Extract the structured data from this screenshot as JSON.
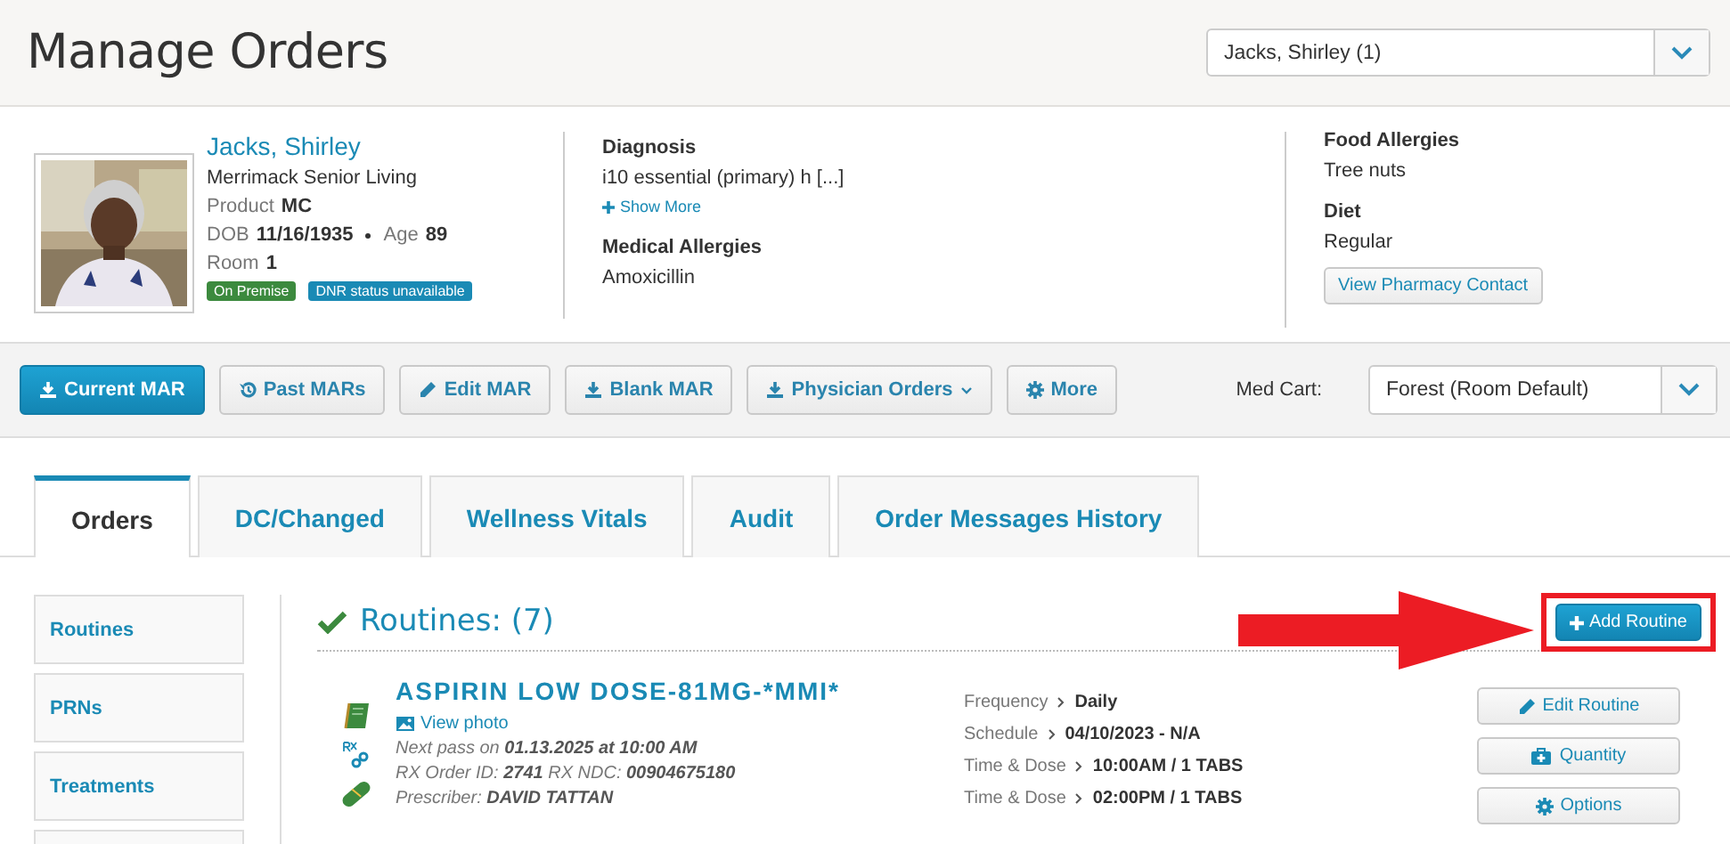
{
  "header": {
    "title": "Manage Orders",
    "resident_select": "Jacks, Shirley (1)"
  },
  "patient": {
    "name": "Jacks, Shirley",
    "facility": "Merrimack Senior Living",
    "product_label": "Product",
    "product": "MC",
    "dob_label": "DOB",
    "dob": "11/16/1935",
    "age_label": "Age",
    "age": "89",
    "room_label": "Room",
    "room": "1",
    "badges": [
      {
        "label": "On Premise",
        "color": "#3c8a3e"
      },
      {
        "label": "DNR status unavailable",
        "color": "#1a8ab5"
      }
    ]
  },
  "diagnosis": {
    "title": "Diagnosis",
    "value": "i10 essential (primary) h [...]",
    "show_more": "Show More"
  },
  "medical_allergies": {
    "title": "Medical Allergies",
    "value": "Amoxicillin"
  },
  "food_allergies": {
    "title": "Food Allergies",
    "value": "Tree nuts"
  },
  "diet": {
    "title": "Diet",
    "value": "Regular"
  },
  "pharmacy_button": "View Pharmacy Contact",
  "toolbar": {
    "buttons": [
      {
        "label": "Current MAR",
        "primary": true,
        "dropdown": false
      },
      {
        "label": "Past MARs",
        "primary": false,
        "dropdown": false
      },
      {
        "label": "Edit MAR",
        "primary": false,
        "dropdown": false
      },
      {
        "label": "Blank MAR",
        "primary": false,
        "dropdown": false
      },
      {
        "label": "Physician Orders",
        "primary": false,
        "dropdown": true
      },
      {
        "label": "More",
        "primary": false,
        "dropdown": false
      }
    ],
    "med_cart_label": "Med Cart:",
    "med_cart": "Forest (Room Default)"
  },
  "tabs": [
    {
      "label": "Orders",
      "selected": true
    },
    {
      "label": "DC/Changed",
      "selected": false
    },
    {
      "label": "Wellness Vitals",
      "selected": false
    },
    {
      "label": "Audit",
      "selected": false
    },
    {
      "label": "Order Messages History",
      "selected": false
    }
  ],
  "sidebar": {
    "items": [
      {
        "label": "Routines"
      },
      {
        "label": "PRNs"
      },
      {
        "label": "Treatments"
      }
    ]
  },
  "section": {
    "title": "Routines: (7)",
    "add_button": "Add Routine"
  },
  "order": {
    "name": "ASPIRIN LOW DOSE-81MG-*MMI*",
    "view_photo": "View photo",
    "next_pass": "Next pass on **01.13.2025 at 10:00 AM**",
    "ids": "RX Order ID: **2741** RX NDC: **00904675180**",
    "prescriber": "Prescriber: **DAVID TATTAN**",
    "details": [
      {
        "label": "Frequency",
        "value": "Daily"
      },
      {
        "label": "Schedule",
        "value": "04/10/2023 - N/A"
      },
      {
        "label": "Time & Dose",
        "value": "10:00AM / 1 TABS"
      },
      {
        "label": "Time & Dose",
        "value": "02:00PM / 1 TABS"
      }
    ],
    "actions": [
      "Edit Routine",
      "Quantity",
      "Options"
    ]
  }
}
